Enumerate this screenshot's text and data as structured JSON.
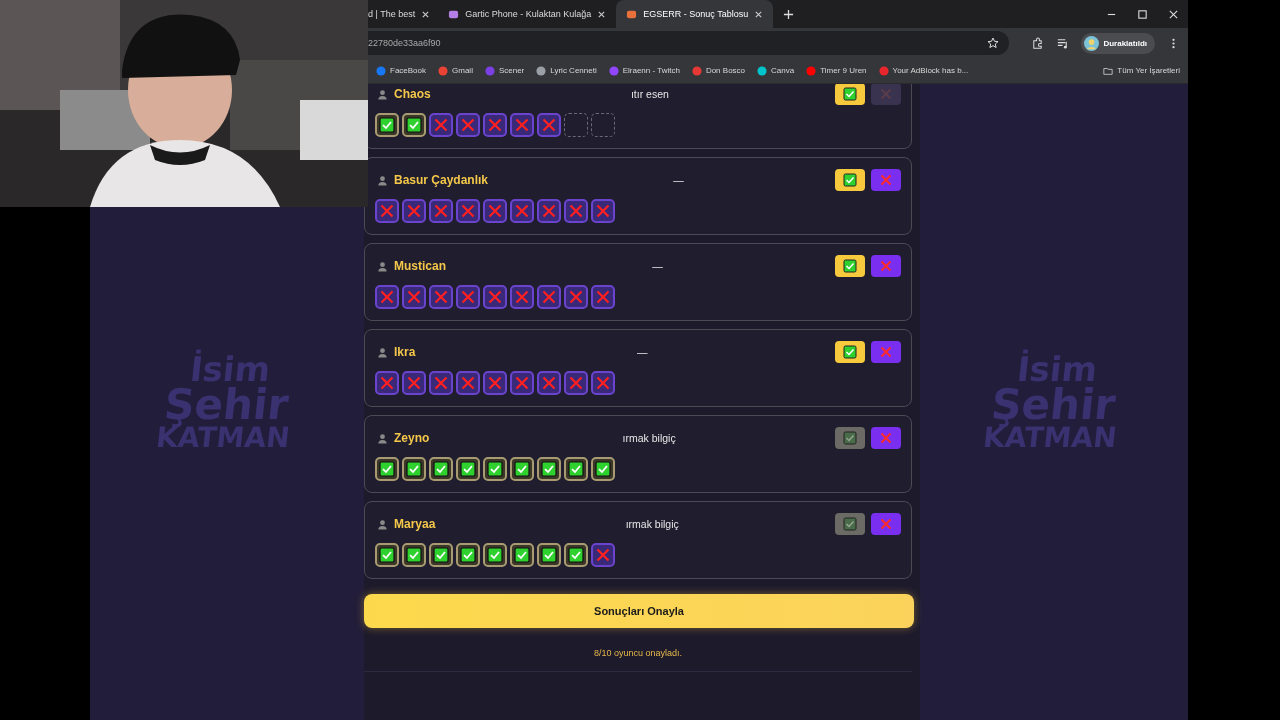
{
  "browser": {
    "tabs": [
      {
        "title": "d | The best",
        "selected": false
      },
      {
        "title": "Gartic Phone - Kulaktan Kulağa",
        "selected": false
      },
      {
        "title": "EGSERR - Sonuç Tablosu",
        "selected": true
      }
    ],
    "address": "22780de33aa6f90",
    "profile": "Duraklatıldı",
    "bookmarks": [
      {
        "label": "FaceBook",
        "color": "#1877f2"
      },
      {
        "label": "Gmail",
        "color": "#ea4335"
      },
      {
        "label": "Scener",
        "color": "#7b3fe4"
      },
      {
        "label": "Lyric Cenneti",
        "color": "#9aa0a6"
      },
      {
        "label": "Elraenn - Twitch",
        "color": "#9146ff"
      },
      {
        "label": "Don Bosco",
        "color": "#e53935"
      },
      {
        "label": "Canva",
        "color": "#00c4cc"
      },
      {
        "label": "Timer 9 Uren",
        "color": "#ff0000"
      },
      {
        "label": "Your AdBlock has b...",
        "color": "#e8262b"
      }
    ],
    "all_bookmarks": "Tüm Yer İşaretleri"
  },
  "side_logos": [
    {
      "lines": [
        "İsim",
        "Şehir",
        "KATMAN"
      ]
    },
    {
      "lines": [
        "İsim",
        "Şehir",
        "KATMAN"
      ]
    }
  ],
  "players": [
    {
      "name": "Chaos",
      "answer": "ıtır esen",
      "approve_enabled": true,
      "reject_enabled": false,
      "marks": [
        {
          "kind": "correct"
        },
        {
          "kind": "correct"
        },
        {
          "kind": "wrong"
        },
        {
          "kind": "wrong"
        },
        {
          "kind": "wrong"
        },
        {
          "kind": "wrong"
        },
        {
          "kind": "wrong"
        },
        {
          "kind": "empty"
        },
        {
          "kind": "empty"
        }
      ]
    },
    {
      "name": "Basur Çaydanlık",
      "answer": "—",
      "approve_enabled": true,
      "reject_enabled": true,
      "marks": [
        {
          "kind": "wrong"
        },
        {
          "kind": "wrong"
        },
        {
          "kind": "wrong"
        },
        {
          "kind": "wrong"
        },
        {
          "kind": "wrong"
        },
        {
          "kind": "wrong"
        },
        {
          "kind": "wrong"
        },
        {
          "kind": "wrong"
        },
        {
          "kind": "wrong"
        }
      ]
    },
    {
      "name": "Mustican",
      "answer": "—",
      "approve_enabled": true,
      "reject_enabled": true,
      "marks": [
        {
          "kind": "wrong"
        },
        {
          "kind": "wrong"
        },
        {
          "kind": "wrong"
        },
        {
          "kind": "wrong"
        },
        {
          "kind": "wrong"
        },
        {
          "kind": "wrong"
        },
        {
          "kind": "wrong"
        },
        {
          "kind": "wrong"
        },
        {
          "kind": "wrong"
        }
      ]
    },
    {
      "name": "Ikra",
      "answer": "—",
      "approve_enabled": true,
      "reject_enabled": true,
      "marks": [
        {
          "kind": "wrong"
        },
        {
          "kind": "wrong"
        },
        {
          "kind": "wrong"
        },
        {
          "kind": "wrong"
        },
        {
          "kind": "wrong"
        },
        {
          "kind": "wrong"
        },
        {
          "kind": "wrong"
        },
        {
          "kind": "wrong"
        },
        {
          "kind": "wrong"
        }
      ]
    },
    {
      "name": "Zeyno",
      "answer": "ırmak bilgiç",
      "approve_enabled": false,
      "reject_enabled": true,
      "marks": [
        {
          "kind": "correct"
        },
        {
          "kind": "correct"
        },
        {
          "kind": "correct"
        },
        {
          "kind": "correct"
        },
        {
          "kind": "correct"
        },
        {
          "kind": "correct"
        },
        {
          "kind": "correct"
        },
        {
          "kind": "correct"
        },
        {
          "kind": "correct"
        }
      ]
    },
    {
      "name": "Maryaa",
      "answer": "ırmak bilgiç",
      "approve_enabled": false,
      "reject_enabled": true,
      "marks": [
        {
          "kind": "correct"
        },
        {
          "kind": "correct"
        },
        {
          "kind": "correct"
        },
        {
          "kind": "correct"
        },
        {
          "kind": "correct"
        },
        {
          "kind": "correct"
        },
        {
          "kind": "correct"
        },
        {
          "kind": "correct"
        },
        {
          "kind": "wrong"
        }
      ]
    }
  ],
  "confirm_button": "Sonuçları Onayla",
  "status": "8/10 oyuncu onayladı."
}
